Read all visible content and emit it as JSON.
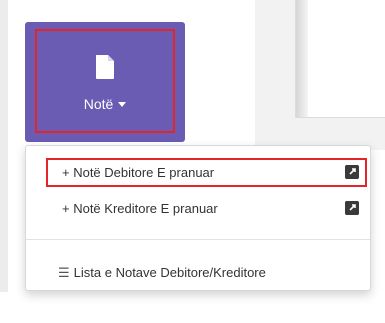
{
  "note_button": {
    "label": "Notë",
    "icon": "document-icon",
    "color": "#6a5bb3"
  },
  "dropdown": {
    "items": [
      {
        "label": "+ Notë Debitore E pranuar",
        "icon": "external-link-icon"
      },
      {
        "label": "+ Notë Kreditore E pranuar",
        "icon": "external-link-icon"
      },
      {
        "label": "Lista e Notave Debitore/Kreditore",
        "icon": "list-icon",
        "icon_glyph": "☰"
      }
    ]
  },
  "highlight_color": "#e3242b"
}
